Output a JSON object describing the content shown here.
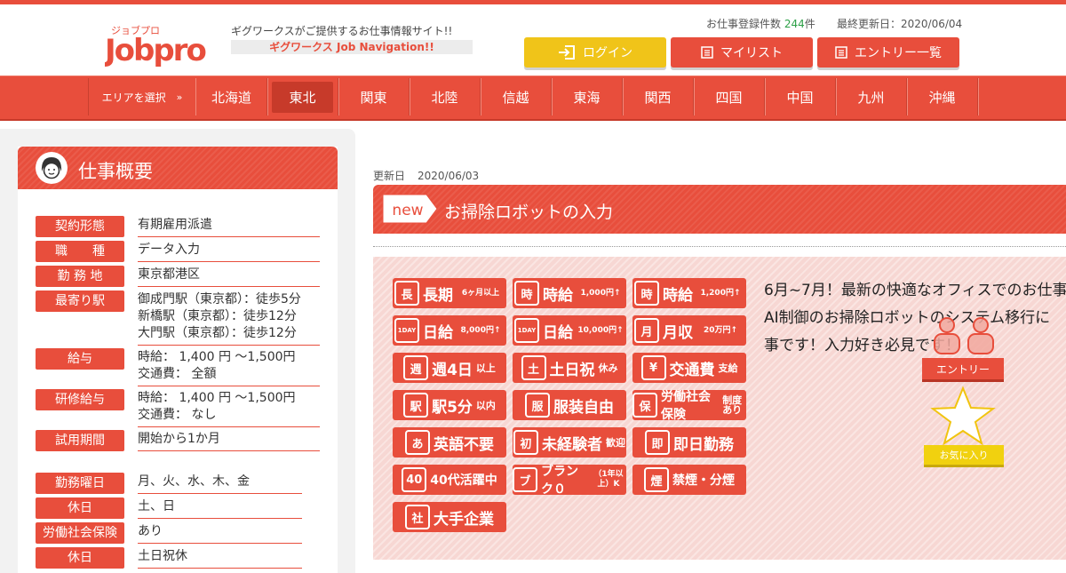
{
  "header": {
    "logo_text": "Jobpro",
    "logo_kana": "ジョブプロ",
    "tagline": "ギグワークスがご提供するお仕事情報サイト!!",
    "subtitle": "ギグワークス Job Navigation!!",
    "job_count_label": "お仕事登録件数",
    "job_count": "244",
    "job_count_unit": "件",
    "last_updated": "最終更新日：2020/06/04",
    "buttons": {
      "login": "ログイン",
      "mylist": "マイリスト",
      "entries": "エントリー一覧"
    }
  },
  "nav": {
    "area_label": "エリアを選択",
    "area_arrow": "»",
    "regions": [
      "北海道",
      "東北",
      "関東",
      "北陸",
      "信越",
      "東海",
      "関西",
      "四国",
      "中国",
      "九州",
      "沖縄"
    ],
    "active_region": "東北"
  },
  "sidebar": {
    "title": "仕事概要",
    "rows": [
      {
        "label": "契約形態",
        "value": [
          "有期雇用派遣"
        ]
      },
      {
        "label": "職　　種",
        "value": [
          "データ入力"
        ]
      },
      {
        "label": "勤 務 地",
        "value": [
          "東京都港区"
        ]
      },
      {
        "label": "最寄り駅",
        "value": [
          "御成門駅（東京都）：徒歩5分",
          "新橋駅（東京都）：徒歩12分",
          "大門駅（東京都）：徒歩12分"
        ]
      },
      {
        "label": "給与",
        "value": [
          "時給： 1,400 円 ～1,500円",
          "交通費： 全額"
        ]
      },
      {
        "label": "研修給与",
        "value": [
          "時給： 1,400 円 ～1,500円",
          "交通費： なし"
        ]
      },
      {
        "label": "試用期間",
        "value": [
          "開始から1か月"
        ]
      },
      {
        "label": "勤務曜日",
        "value": [
          "月、火、水、木、金"
        ]
      },
      {
        "label": "休日",
        "value": [
          "土、日"
        ]
      },
      {
        "label": "労働社会保険",
        "value": [
          "あり"
        ]
      },
      {
        "label": "休日",
        "value": [
          "土日祝休"
        ]
      }
    ]
  },
  "job": {
    "updated_label": "更新日",
    "updated_date": "2020/06/03",
    "new_tag": "new",
    "title": "お掃除ロボットの入力",
    "description": [
      "6月~7月！最新の快適なオフィスでのお仕事",
      "AI制御のお掃除ロボットのシステム移行に",
      "事です！入力好き必見です！"
    ]
  },
  "badges": [
    {
      "icon": "長",
      "main": "長期",
      "small": "6ヶ月以上"
    },
    {
      "icon": "時",
      "main": "時給",
      "small": "1,000円↑"
    },
    {
      "icon": "時",
      "main": "時給",
      "small": "1,200円↑"
    },
    {
      "icon": "1DAY",
      "main": "日給",
      "small": "8,000円↑"
    },
    {
      "icon": "1DAY",
      "main": "日給",
      "small": "10,000円↑"
    },
    {
      "icon": "月",
      "main": "月収",
      "small": "20万円↑"
    },
    {
      "icon": "週",
      "main": "週4日",
      "small": "以上"
    },
    {
      "icon": "土",
      "main": "土日祝",
      "small": "休み"
    },
    {
      "icon": "¥",
      "main": "交通費",
      "small": "支給"
    },
    {
      "icon": "駅",
      "main": "駅5分",
      "small": "以内"
    },
    {
      "icon": "服",
      "main": "服装自由",
      "small": ""
    },
    {
      "icon": "保",
      "main": "労働社会保険",
      "small": "制度あり"
    },
    {
      "icon": "あ",
      "main": "英語不要",
      "small": ""
    },
    {
      "icon": "初",
      "main": "未経験者",
      "small": "歓迎"
    },
    {
      "icon": "即",
      "main": "即日勤務",
      "small": ""
    },
    {
      "icon": "40",
      "main": "40代活躍中",
      "small": ""
    },
    {
      "icon": "ブ",
      "main": "ブランク０",
      "small": "（1年以上）K"
    },
    {
      "icon": "煙",
      "main": "禁煙・分煙",
      "small": ""
    },
    {
      "icon": "社",
      "main": "大手企業",
      "small": ""
    }
  ],
  "actions": {
    "entry": "エントリー",
    "favorite": "お気に入り"
  },
  "colors": {
    "brand": "#e84e3c",
    "login": "#f0c419",
    "count": "#2ea048"
  }
}
